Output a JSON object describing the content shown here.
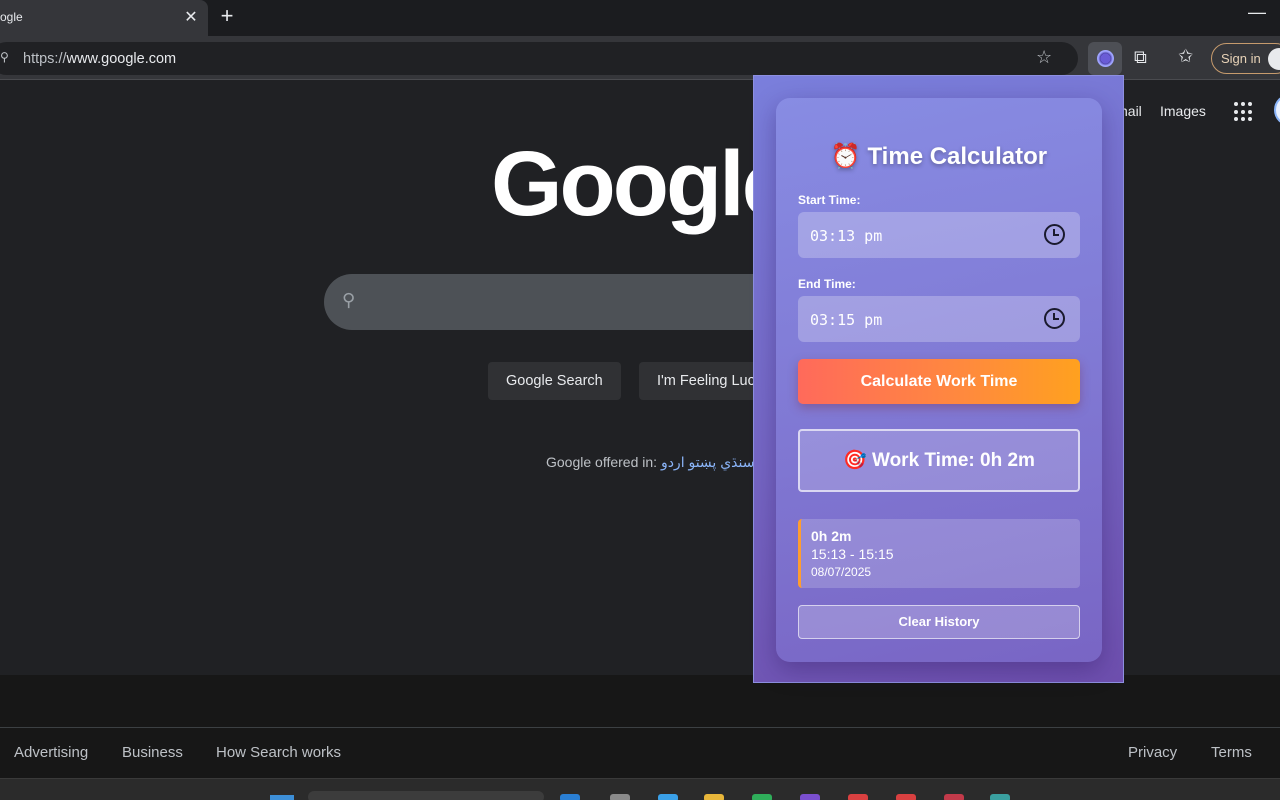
{
  "browser": {
    "tab_title": "ogle",
    "url_scheme": "https://",
    "url_host": "www.google.com",
    "signin_label": "Sign in"
  },
  "google": {
    "top_links": [
      "nail",
      "Images"
    ],
    "logo": "Google",
    "search_button": "Google Search",
    "lucky_button": "I'm Feeling Lucky",
    "offered_in_label": "Google offered in:",
    "offered_languages": "سنڌي پښتو اردو",
    "footer_left": [
      "Advertising",
      "Business",
      "How Search works"
    ],
    "footer_right": [
      "Privacy",
      "Terms"
    ]
  },
  "popup": {
    "title": "⏰ Time Calculator",
    "start_label": "Start Time:",
    "start_value": "03:13 pm",
    "end_label": "End Time:",
    "end_value": "03:15 pm",
    "calculate_label": "Calculate Work Time",
    "result_text": "🎯 Work Time: 0h 2m",
    "history": [
      {
        "duration": "0h 2m",
        "range": "15:13 - 15:15",
        "date": "08/07/2025"
      }
    ],
    "clear_label": "Clear History",
    "accent_colors": {
      "button_start": "#ff6a5b",
      "button_end": "#ffa11f",
      "history_border": "#ff9d2e"
    }
  },
  "icons": {
    "close": "close-icon",
    "new_tab": "plus-icon",
    "minimize": "minimize-icon",
    "lock": "site-info-icon",
    "bookmark": "star-icon",
    "extension_active": "time-calculator-extension-icon",
    "extensions": "puzzle-icon",
    "favorites": "favorites-icon",
    "apps": "apps-grid-icon",
    "search": "search-icon",
    "clock": "clock-icon"
  }
}
